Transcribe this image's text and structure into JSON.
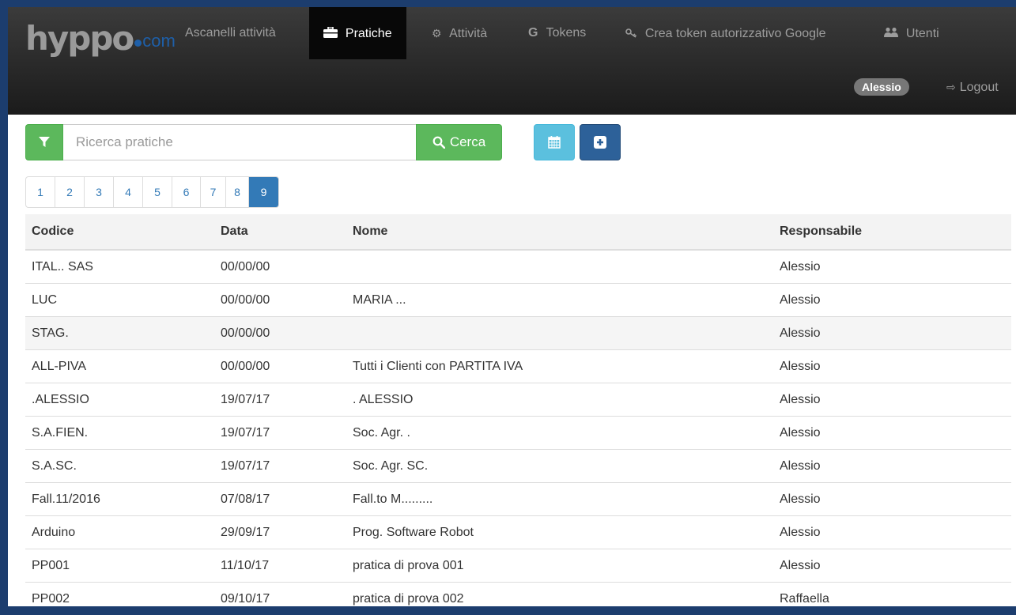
{
  "brand": {
    "main": "hyppo",
    "tld": "com"
  },
  "nav": {
    "items": [
      {
        "label": "Ascanelli attività",
        "icon": ""
      },
      {
        "label": "Pratiche",
        "icon": "briefcase-icon"
      },
      {
        "label": "Attività",
        "icon": "cogs-icon"
      },
      {
        "label": "Tokens",
        "icon": "google-icon"
      },
      {
        "label": "Crea token autorizzativo Google",
        "icon": "key-icon"
      },
      {
        "label": "Utenti",
        "icon": "users-icon"
      }
    ],
    "user": "Alessio",
    "logout": "Logout"
  },
  "search": {
    "placeholder": "Ricerca pratiche",
    "value": "",
    "button": "Cerca"
  },
  "pagination": {
    "pages": [
      "1",
      "2",
      "3",
      "4",
      "5",
      "6",
      "7",
      "8",
      "9"
    ],
    "active": "9"
  },
  "table": {
    "headers": [
      "Codice",
      "Data",
      "Nome",
      "Responsabile"
    ],
    "rows": [
      [
        "ITAL.. SAS",
        "00/00/00",
        "",
        "Alessio"
      ],
      [
        "LUC",
        "00/00/00",
        "MARIA ...",
        "Alessio"
      ],
      [
        "STAG.",
        "00/00/00",
        "",
        "Alessio"
      ],
      [
        "ALL-PIVA",
        "00/00/00",
        "Tutti i Clienti con PARTITA IVA",
        "Alessio"
      ],
      [
        ".ALESSIO",
        "19/07/17",
        ". ALESSIO",
        "Alessio"
      ],
      [
        "S.A.FIEN.",
        "19/07/17",
        "Soc. Agr. .",
        "Alessio"
      ],
      [
        "S.A.SC.",
        "19/07/17",
        "Soc. Agr. SC.",
        "Alessio"
      ],
      [
        "Fall.11/2016",
        "07/08/17",
        "Fall.to M.........",
        "Alessio"
      ],
      [
        "Arduino",
        "29/09/17",
        "Prog. Software Robot",
        "Alessio"
      ],
      [
        "PP001",
        "11/10/17",
        "pratica di prova 001",
        "Alessio"
      ],
      [
        "PP002",
        "09/10/17",
        "pratica di prova 002",
        "Raffaella"
      ]
    ]
  },
  "colors": {
    "navbar": "#222222",
    "success": "#5cb85c",
    "info": "#5bc0de",
    "primary": "#337ab7",
    "brand": "#1e5fa8"
  }
}
